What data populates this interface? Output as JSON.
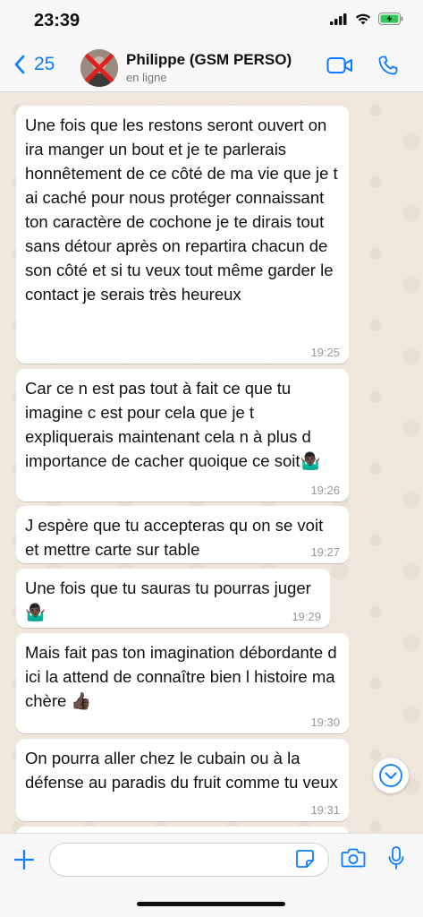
{
  "status_bar": {
    "time": "23:39"
  },
  "header": {
    "back_count": "25",
    "contact_name": "Philippe (GSM PERSO)",
    "status": "en ligne"
  },
  "messages": [
    {
      "text": "Une fois que les restons seront ouvert on ira manger un bout et je te parlerais honnêtement de ce côté de ma vie que je t ai caché pour nous protéger connaissant ton caractère de cochone je te dirais tout sans détour après on repartira chacun de son côté et si tu veux tout même garder le contact je serais très heureux",
      "time": "19:25"
    },
    {
      "text": "Car ce n est pas tout à fait ce que tu imagine c est pour cela que je t expliquerais maintenant cela n à plus d importance de cacher quoique ce soit🤷🏿‍♂️",
      "time": "19:26"
    },
    {
      "text": "J espère que tu accepteras qu on se voit et mettre carte sur table",
      "time": "19:27"
    },
    {
      "text": "Une fois que tu sauras tu pourras juger🤷🏿‍♂️",
      "time": "19:29"
    },
    {
      "text": "Mais fait pas ton imagination débordante d ici la attend de connaître bien l histoire ma chère 👍🏿",
      "time": "19:30"
    },
    {
      "text": "On pourra aller chez le cubain ou à la défense au paradis du fruit comme tu veux",
      "time": "19:31"
    }
  ],
  "icons": {
    "back": "chevron-left-icon",
    "video": "video-call-icon",
    "phone": "phone-icon",
    "add": "plus-icon",
    "sticker": "sticker-icon",
    "camera": "camera-icon",
    "mic": "microphone-icon",
    "scroll": "chevron-down-icon"
  },
  "colors": {
    "accent": "#0a7cff",
    "chat_bg": "#efe7dc",
    "bubble": "#ffffff"
  }
}
